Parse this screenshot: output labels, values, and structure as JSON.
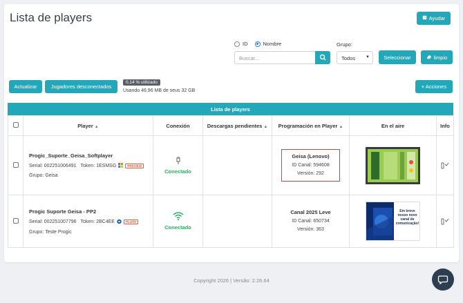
{
  "header": {
    "title": "Lista de players",
    "help_label": "Ayudar"
  },
  "filters": {
    "radio_id": "ID",
    "radio_nombre": "Nombre",
    "selected_radio": "Nombre",
    "search_placeholder": "Buscar...",
    "grupo_label": "Grupo:",
    "grupo_value": "Todos",
    "seleccionar_label": "Seleccionar",
    "limpio_label": "limpio"
  },
  "toolbar": {
    "actualizar_label": "Actualizar",
    "desconectados_label": "Jugadores desconectados",
    "usage_badge": "0.14 % utilizado",
    "usage_text": "Usando 46.96 MB de seus 32 GB",
    "acciones_label": "+ Acciones"
  },
  "table": {
    "title": "Lista de players",
    "columns": [
      "Player",
      "Conexión",
      "Descargas pendientes",
      "Programación en Player",
      "En el aire",
      "Info"
    ],
    "rows": [
      {
        "name": "Progic_Suporte_Geisa_Softplayer",
        "serial": "Serial: 002251006491",
        "token": "Token: 1ESMSG",
        "tag": "PREVIEW",
        "grupo": "Grupo: Geisa",
        "conexion": "Conectado",
        "prog_title": "Geisa (Lenovo)",
        "prog_canal": "ID Canal: 594608",
        "prog_version": "Versión: 292"
      },
      {
        "name": "Progic Suporte Geisa - PP2",
        "serial": "Serial: 002251007796",
        "token": "Token: 2BC4EE",
        "tag": "PLUTO",
        "grupo": "Grupo: Teste Progic",
        "conexion": "Conectado",
        "prog_title": "Canal 2025 Leve",
        "prog_canal": "ID Canal: 650734",
        "prog_version": "Versión: 363",
        "thumb_text": "Em breve nosso novo canal de comunicação!"
      }
    ]
  },
  "footer": {
    "text": "Copyright 2026 | Versão: 2.26.64"
  },
  "colors": {
    "accent": "#22a8b8",
    "connected": "#27ae60",
    "highlight": "#d9403a"
  }
}
